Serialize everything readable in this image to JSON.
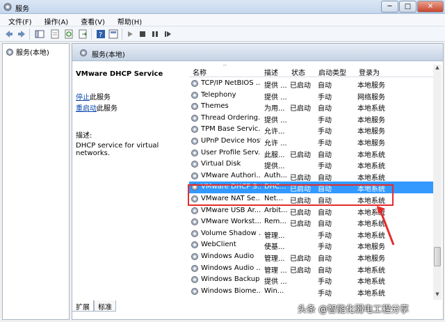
{
  "window": {
    "title": "服务",
    "min": "─",
    "max": "□",
    "close": "✕"
  },
  "menu": [
    "文件(F)",
    "操作(A)",
    "查看(V)",
    "帮助(H)"
  ],
  "tree": {
    "root": "服务(本地)"
  },
  "header": {
    "title": "服务(本地)"
  },
  "detail": {
    "service_name": "VMware DHCP Service",
    "stop_link": "停止",
    "stop_rest": "此服务",
    "restart_link": "重启动",
    "restart_rest": "此服务",
    "desc_label": "描述:",
    "desc_text": "DHCP service for virtual networks."
  },
  "columns": {
    "name": "名称",
    "desc": "描述",
    "status": "状态",
    "start": "启动类型",
    "logon": "登录为"
  },
  "rows": [
    {
      "name": "TCP/IP NetBIOS ...",
      "desc": "提供 ...",
      "status": "已启动",
      "start": "自动",
      "logon": "本地服务"
    },
    {
      "name": "Telephony",
      "desc": "提供 ...",
      "status": "",
      "start": "手动",
      "logon": "网络服务"
    },
    {
      "name": "Themes",
      "desc": "为用...",
      "status": "已启动",
      "start": "自动",
      "logon": "本地系统"
    },
    {
      "name": "Thread Ordering...",
      "desc": "提供 ...",
      "status": "",
      "start": "手动",
      "logon": "本地服务"
    },
    {
      "name": "TPM Base Servic...",
      "desc": "允许...",
      "status": "",
      "start": "手动",
      "logon": "本地服务"
    },
    {
      "name": "UPnP Device Host",
      "desc": "允许 ...",
      "status": "",
      "start": "手动",
      "logon": "本地服务"
    },
    {
      "name": "User Profile Serv...",
      "desc": "此服...",
      "status": "已启动",
      "start": "自动",
      "logon": "本地系统"
    },
    {
      "name": "Virtual Disk",
      "desc": "提供...",
      "status": "",
      "start": "手动",
      "logon": "本地系统"
    },
    {
      "name": "VMware Authori...",
      "desc": "Auth...",
      "status": "已启动",
      "start": "自动",
      "logon": "本地系统"
    },
    {
      "name": "VMware DHCP S...",
      "desc": "DHC...",
      "status": "已启动",
      "start": "自动",
      "logon": "本地系统"
    },
    {
      "name": "VMware NAT Se...",
      "desc": "Net...",
      "status": "已启动",
      "start": "自动",
      "logon": "本地系统"
    },
    {
      "name": "VMware USB Ar...",
      "desc": "Arbit...",
      "status": "已启动",
      "start": "自动",
      "logon": "本地系统"
    },
    {
      "name": "VMware Workst...",
      "desc": "Rem...",
      "status": "已启动",
      "start": "自动",
      "logon": "本地系统"
    },
    {
      "name": "Volume Shadow ...",
      "desc": "管理...",
      "status": "",
      "start": "手动",
      "logon": "本地系统"
    },
    {
      "name": "WebClient",
      "desc": "使基...",
      "status": "",
      "start": "手动",
      "logon": "本地服务"
    },
    {
      "name": "Windows Audio",
      "desc": "管理...",
      "status": "已启动",
      "start": "自动",
      "logon": "本地服务"
    },
    {
      "name": "Windows Audio ...",
      "desc": "管理 ...",
      "status": "已启动",
      "start": "自动",
      "logon": "本地系统"
    },
    {
      "name": "Windows Backup",
      "desc": "提供 ...",
      "status": "",
      "start": "手动",
      "logon": "本地系统"
    },
    {
      "name": "Windows Biome...",
      "desc": "Win...",
      "status": "",
      "start": "手动",
      "logon": "本地系统"
    }
  ],
  "tabs": [
    "扩展",
    "标准"
  ],
  "watermark": "头条 @智能化弱电工程分享",
  "colors": {
    "selection": "#3399ff",
    "highlight_box": "#e52b2b"
  }
}
